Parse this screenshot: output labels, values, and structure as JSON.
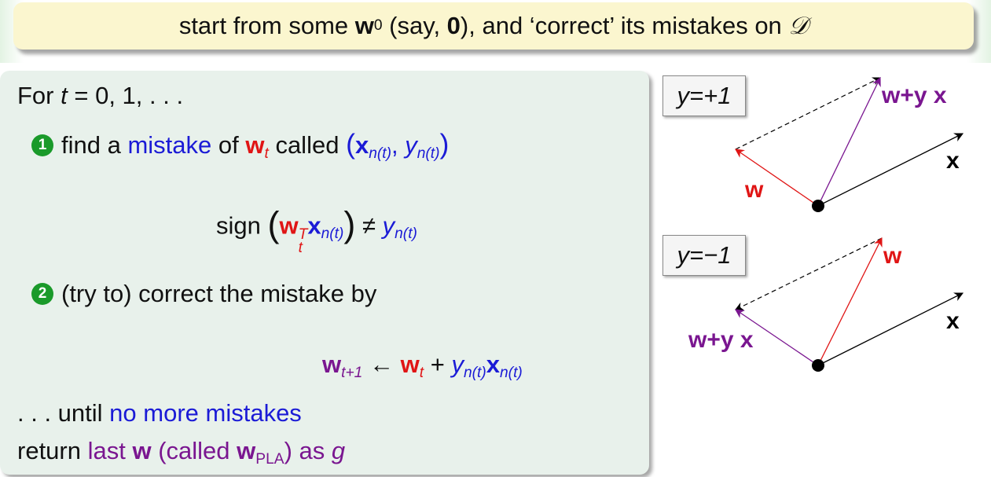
{
  "header": {
    "text_before": "start from some ",
    "w": "w",
    "w_sub": "0",
    "text_say": " (say, ",
    "zero": "0",
    "text_after": "), and ‘correct’ its mistakes on ",
    "D": "𝒟"
  },
  "algorithm": {
    "for_line": "For ",
    "t": "t",
    "for_range": " = 0, 1, . . .",
    "step1_num": "1",
    "step1_text": "find a ",
    "step1_mistake": "mistake",
    "step1_of": " of ",
    "step1_called": " called ",
    "sign": "sign",
    "neq": "≠",
    "step2_num": "2",
    "step2_text": "(try to) correct the mistake by",
    "arrow": "←",
    "plus": "+",
    "until_prefix": ". . . until ",
    "until_highlight": "no more mistakes",
    "return_prefix": "return ",
    "return_last": "last ",
    "return_called": " (called ",
    "return_pla": "PLA",
    "return_as": ") as ",
    "g": "g"
  },
  "math": {
    "w": "w",
    "x": "x",
    "y": "y",
    "t": "t",
    "t_plus_1": "t+1",
    "n_t": "n(t)",
    "T": "T"
  },
  "diagram": {
    "pos_label": "y=+1",
    "neg_label": "y=−1",
    "w": "w",
    "x": "x",
    "w_plus_yx": "w+y x"
  },
  "colors": {
    "blue": "#1b1bd6",
    "red": "#e01515",
    "purple": "#7a1690",
    "bullet_green": "#1a9a2a",
    "header_bg": "#fbf6cf",
    "box_bg": "#e8f1eb"
  }
}
